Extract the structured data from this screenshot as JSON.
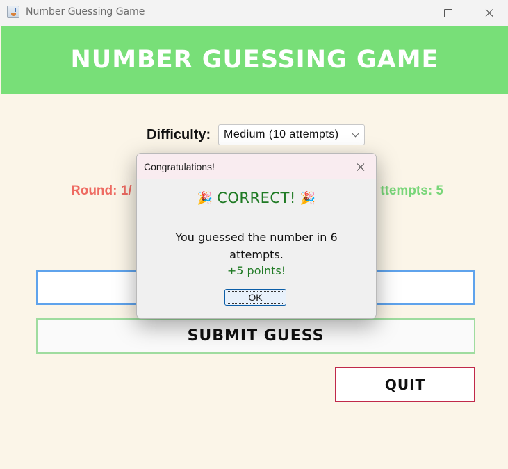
{
  "window": {
    "title": "Number Guessing Game"
  },
  "header": {
    "title": "NUMBER GUESSING GAME"
  },
  "controls": {
    "difficulty_label": "Difficulty:",
    "difficulty_value": "Medium (10 attempts)",
    "round_label": "Round: 1/",
    "attempts_label": "ttempts: 5",
    "guess_input_value": "",
    "submit_label": "SUBMIT GUESS",
    "quit_label": "QUIT"
  },
  "dialog": {
    "title": "Congratulations!",
    "headline": "CORRECT!",
    "headline_icon": "🎉",
    "message": "You guessed the number in 6 attempts.",
    "points": "+5 points!",
    "ok_label": "OK"
  },
  "colors": {
    "header_bg": "#78df78",
    "round_color": "#ee6b62",
    "attempts_color": "#79d679",
    "input_border": "#5fa3ec",
    "quit_border": "#c0294a"
  }
}
